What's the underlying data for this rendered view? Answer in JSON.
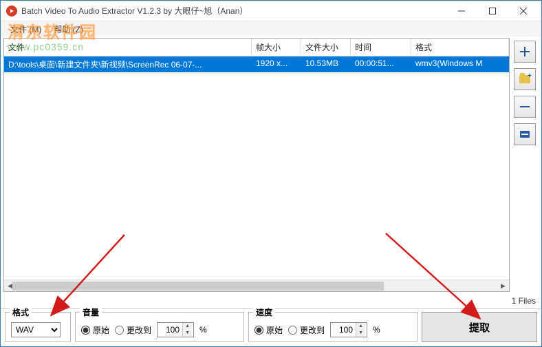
{
  "window": {
    "title": "Batch Video To Audio Extractor V1.2.3 by 大眼仔~旭（Anan）"
  },
  "menu": {
    "file": "文件 (M)",
    "help": "帮助 (Z)"
  },
  "columns": {
    "file": "文件",
    "frameSize": "帧大小",
    "fileSize": "文件大小",
    "time": "时间",
    "format": "格式"
  },
  "rows": [
    {
      "file": "D:\\tools\\桌面\\新建文件夹\\新视频\\ScreenRec 06-07-...",
      "frameSize": "1920 x...",
      "fileSize": "10.53MB",
      "time": "00:00:51...",
      "format": "wmv3(Windows M"
    }
  ],
  "status": {
    "files": "1 Files"
  },
  "footer": {
    "formatLabel": "格式",
    "formatValue": "WAV",
    "volumeLabel": "音量",
    "speedLabel": "速度",
    "original": "原始",
    "changeTo": "更改到",
    "volumeValue": "100",
    "speedValue": "100",
    "percent": "%",
    "extract": "提取"
  },
  "watermark": {
    "big": "渭东软件园",
    "url": "www.pc0359.cn"
  }
}
